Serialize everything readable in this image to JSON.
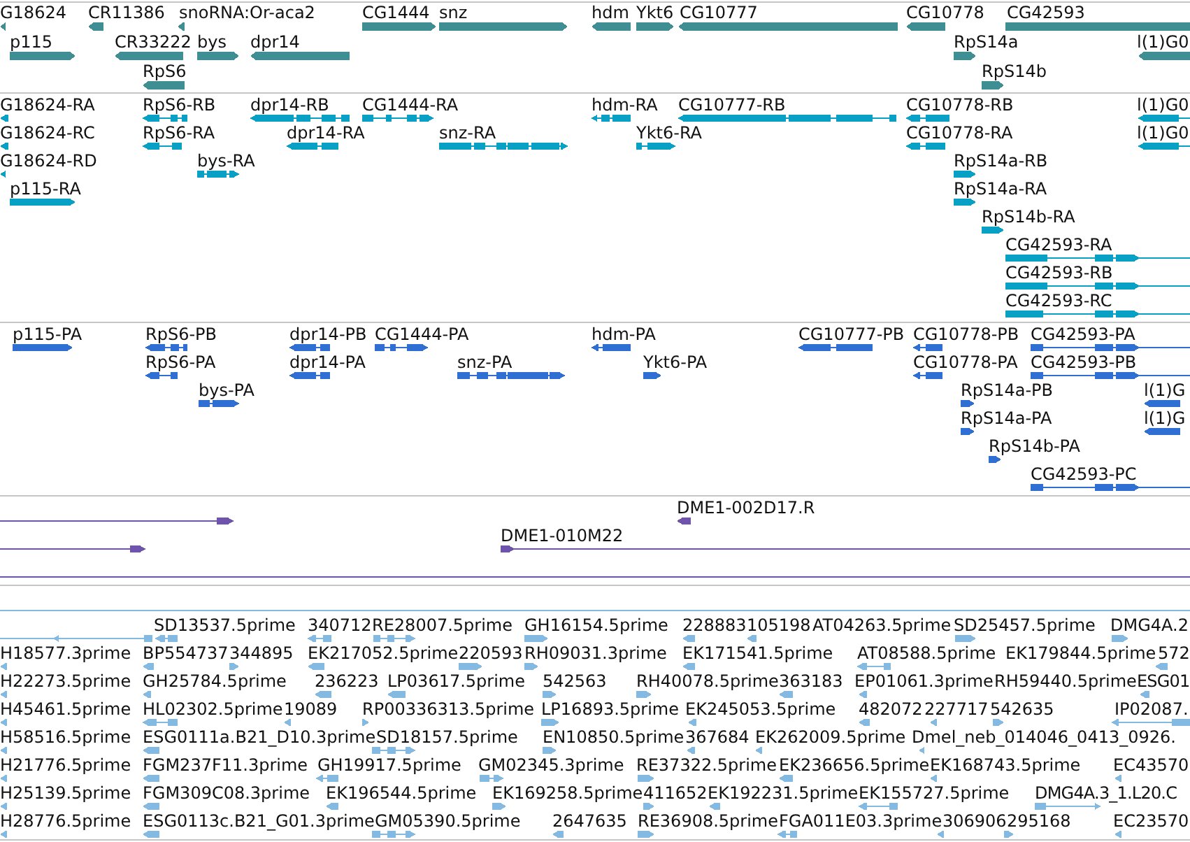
{
  "tracks": [
    {
      "kind": "gene",
      "rows": [
        {
          "features": [
            {
              "label": "G18624",
              "forward": false
            },
            {
              "label": "CR11386",
              "forward": false
            },
            {
              "label": "snoRNA:Or-aca2",
              "forward": false
            },
            {
              "label": "CG1444",
              "forward": true
            },
            {
              "label": "snz",
              "forward": true
            },
            {
              "label": "hdm",
              "forward": false
            },
            {
              "label": "Ykt6",
              "forward": true
            },
            {
              "label": "CG10777",
              "forward": false
            },
            {
              "label": "CG10778",
              "forward": false
            },
            {
              "label": "CG42593",
              "forward": true
            }
          ]
        },
        {
          "features": [
            {
              "label": "p115",
              "forward": true
            },
            {
              "label": "CR33222",
              "forward": false
            },
            {
              "label": "bys",
              "forward": true
            },
            {
              "label": "dpr14",
              "forward": false
            },
            {
              "label": "RpS14a",
              "forward": true
            },
            {
              "label": "l(1)G0",
              "forward": false
            }
          ]
        },
        {
          "features": [
            {
              "label": "RpS6",
              "forward": false
            },
            {
              "label": "RpS14b",
              "forward": true
            }
          ]
        }
      ]
    },
    {
      "kind": "transcript",
      "rows": [
        {
          "features": [
            {
              "label": "G18624-RA",
              "forward": false
            },
            {
              "label": "RpS6-RB",
              "forward": false
            },
            {
              "label": "dpr14-RB",
              "forward": false
            },
            {
              "label": "CG1444-RA",
              "forward": true
            },
            {
              "label": "hdm-RA",
              "forward": false
            },
            {
              "label": "CG10777-RB",
              "forward": false
            },
            {
              "label": "CG10778-RB",
              "forward": false
            },
            {
              "label": "l(1)G0",
              "forward": false
            }
          ]
        },
        {
          "features": [
            {
              "label": "G18624-RC",
              "forward": false
            },
            {
              "label": "RpS6-RA",
              "forward": false
            },
            {
              "label": "dpr14-RA",
              "forward": false
            },
            {
              "label": "snz-RA",
              "forward": true
            },
            {
              "label": "Ykt6-RA",
              "forward": true
            },
            {
              "label": "CG10778-RA",
              "forward": false
            },
            {
              "label": "l(1)G0",
              "forward": false
            }
          ]
        },
        {
          "features": [
            {
              "label": "G18624-RD",
              "forward": false
            },
            {
              "label": "bys-RA",
              "forward": true
            },
            {
              "label": "RpS14a-RB",
              "forward": true
            }
          ]
        },
        {
          "features": [
            {
              "label": "p115-RA",
              "forward": true
            },
            {
              "label": "RpS14a-RA",
              "forward": true
            }
          ]
        },
        {
          "features": [
            {
              "label": "RpS14b-RA",
              "forward": true
            }
          ]
        },
        {
          "features": [
            {
              "label": "CG42593-RA",
              "forward": true
            }
          ]
        },
        {
          "features": [
            {
              "label": "CG42593-RB",
              "forward": true
            }
          ]
        },
        {
          "features": [
            {
              "label": "CG42593-RC",
              "forward": true
            }
          ]
        }
      ]
    },
    {
      "kind": "protein",
      "rows": [
        {
          "features": [
            {
              "label": "p115-PA",
              "forward": true
            },
            {
              "label": "RpS6-PB",
              "forward": false
            },
            {
              "label": "dpr14-PB",
              "forward": false
            },
            {
              "label": "CG1444-PA",
              "forward": true
            },
            {
              "label": "hdm-PA",
              "forward": false
            },
            {
              "label": "CG10777-PB",
              "forward": false
            },
            {
              "label": "CG10778-PB",
              "forward": false
            },
            {
              "label": "CG42593-PA",
              "forward": true
            }
          ]
        },
        {
          "features": [
            {
              "label": "RpS6-PA",
              "forward": false
            },
            {
              "label": "dpr14-PA",
              "forward": false
            },
            {
              "label": "snz-PA",
              "forward": true
            },
            {
              "label": "Ykt6-PA",
              "forward": true
            },
            {
              "label": "CG10778-PA",
              "forward": false
            },
            {
              "label": "CG42593-PB",
              "forward": true
            }
          ]
        },
        {
          "features": [
            {
              "label": "bys-PA",
              "forward": true
            },
            {
              "label": "RpS14a-PB",
              "forward": true
            },
            {
              "label": "l(1)G",
              "forward": false
            }
          ]
        },
        {
          "features": [
            {
              "label": "RpS14a-PA",
              "forward": true
            },
            {
              "label": "l(1)G",
              "forward": false
            }
          ]
        },
        {
          "features": [
            {
              "label": "RpS14b-PA",
              "forward": true
            }
          ]
        },
        {
          "features": [
            {
              "label": "CG42593-PC",
              "forward": true
            }
          ]
        }
      ]
    },
    {
      "kind": "clone",
      "rows": [
        {
          "features": [
            {
              "forward": true
            },
            {
              "label": "DME1-002D17.R",
              "forward": false
            }
          ]
        },
        {
          "features": [
            {
              "forward": true
            },
            {
              "label": "DME1-010M22",
              "forward": true
            }
          ]
        },
        {
          "spanning_feature": true
        }
      ]
    },
    {
      "kind": "est",
      "rows": [
        {
          "spanning_feature": true
        },
        {
          "features": [
            {
              "forward": false
            },
            {
              "label": "SD13537.5prime",
              "forward": false
            },
            {
              "label": "340712",
              "forward": false
            },
            {
              "label": "RE28007.5prime",
              "forward": true
            },
            {
              "label": "GH16154.5prime",
              "forward": true
            },
            {
              "label": "228883",
              "forward": false
            },
            {
              "label": "105198",
              "forward": false
            },
            {
              "label": "AT04263.5prime"
            },
            {
              "label": "SD25457.5prime",
              "forward": true
            },
            {
              "label": "DMG4A.2",
              "forward": true
            }
          ]
        },
        {
          "features": [
            {
              "label": "H18577.3prime",
              "forward": false
            },
            {
              "label": "BP554737",
              "forward": false
            },
            {
              "label": "344895",
              "forward": true
            },
            {
              "label": "EK217052.5prime",
              "forward": false
            },
            {
              "label": "220593",
              "forward": true
            },
            {
              "label": "RH09031.3prime",
              "forward": true
            },
            {
              "label": "EK171541.5prime",
              "forward": false
            },
            {
              "label": "AT08588.5prime",
              "forward": false
            },
            {
              "label": "EK179844.5prime"
            },
            {
              "label": "572",
              "forward": false
            }
          ]
        },
        {
          "features": [
            {
              "label": "H22273.5prime",
              "forward": false
            },
            {
              "label": "GH25784.5prime",
              "forward": false
            },
            {
              "label": "236223",
              "forward": false
            },
            {
              "label": "LP03617.5prime",
              "forward": false
            },
            {
              "label": "542563",
              "forward": true
            },
            {
              "label": "RH40078.5prime",
              "forward": true
            },
            {
              "label": "363183",
              "forward": false
            },
            {
              "label": "EP01061.3prime",
              "forward": false
            },
            {
              "label": "RH59440.5prime"
            },
            {
              "label": "ESG01",
              "forward": false
            }
          ]
        },
        {
          "features": [
            {
              "label": "H45461.5prime",
              "forward": false
            },
            {
              "label": "HL02302.5prime",
              "forward": false
            },
            {
              "label": "19089",
              "forward": false
            },
            {
              "label": "RP00336313.5prime",
              "forward": true
            },
            {
              "label": "LP16893.5prime",
              "forward": true
            },
            {
              "label": "EK245053.5prime",
              "forward": false
            },
            {
              "label": "482072",
              "forward": false
            },
            {
              "label": "227717",
              "forward": false
            },
            {
              "label": "542635",
              "forward": true
            },
            {
              "label": "IP02087.",
              "forward": false
            }
          ]
        },
        {
          "features": [
            {
              "label": "H58516.5prime",
              "forward": false
            },
            {
              "label": "ESG0111a.B21_D10.3prime",
              "forward": false
            },
            {
              "label": "SD18157.5prime",
              "forward": true
            },
            {
              "label": "EN10850.5prime",
              "forward": true
            },
            {
              "label": "367684",
              "forward": false
            },
            {
              "label": "EK262009.5prime",
              "forward": false
            },
            {
              "label": "Dmel_neb_014046_0413_0926.",
              "forward": false
            }
          ]
        },
        {
          "features": [
            {
              "label": "H21776.5prime",
              "forward": false
            },
            {
              "label": "FGM237F11.3prime",
              "forward": false
            },
            {
              "label": "GH19917.5prime",
              "forward": false
            },
            {
              "label": "GM02345.3prime",
              "forward": true
            },
            {
              "label": "RE37322.5prime",
              "forward": true
            },
            {
              "label": "EK236656.5prime",
              "forward": false
            },
            {
              "label": "EK168743.5prime",
              "forward": false
            },
            {
              "label": "EC43570",
              "forward": false
            }
          ]
        },
        {
          "features": [
            {
              "label": "H25139.5prime",
              "forward": false
            },
            {
              "label": "FGM309C08.3prime",
              "forward": false
            },
            {
              "label": "EK196544.5prime",
              "forward": false
            },
            {
              "label": "EK169258.5prime",
              "forward": true
            },
            {
              "label": "411652",
              "forward": true
            },
            {
              "label": "EK192231.5prime",
              "forward": false
            },
            {
              "label": "EK155727.5prime",
              "forward": false
            },
            {
              "label": "DMG4A.3_1.L20.C",
              "forward": true
            }
          ]
        },
        {
          "features": [
            {
              "label": "H28776.5prime",
              "forward": false
            },
            {
              "label": "ESG0113c.B21_G01.3prime",
              "forward": false
            },
            {
              "label": "GM05390.5prime",
              "forward": true
            },
            {
              "label": "2647635",
              "forward": false
            },
            {
              "label": "RE36908.5prime",
              "forward": true
            },
            {
              "label": "FGA011E03.3prime",
              "forward": false
            },
            {
              "label": "306906",
              "forward": false
            },
            {
              "label": "295168",
              "forward": true
            },
            {
              "label": "EC23570",
              "forward": false
            }
          ]
        }
      ]
    }
  ]
}
